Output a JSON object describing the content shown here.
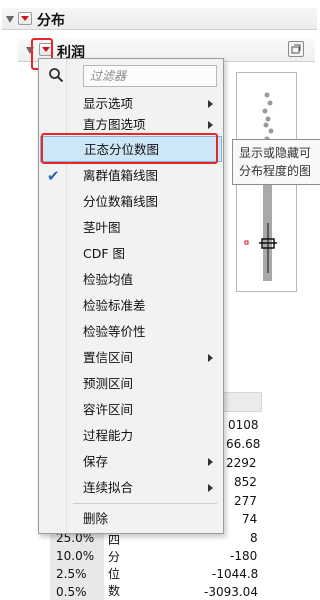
{
  "header": {
    "title": "分布"
  },
  "subheader": {
    "title": "利润"
  },
  "menu": {
    "filter_placeholder": "过滤器",
    "items": [
      {
        "label": "显示选项",
        "submenu": true,
        "checked": false
      },
      {
        "label": "直方图选项",
        "submenu": true,
        "checked": false
      },
      {
        "label": "正态分位数图",
        "submenu": false,
        "checked": false,
        "highlighted": true
      },
      {
        "label": "离群值箱线图",
        "submenu": false,
        "checked": true
      },
      {
        "label": "分位数箱线图",
        "submenu": false,
        "checked": false
      },
      {
        "label": "茎叶图",
        "submenu": false,
        "checked": false
      },
      {
        "label": "CDF 图",
        "submenu": false,
        "checked": false
      },
      {
        "label": "检验均值",
        "submenu": false,
        "checked": false
      },
      {
        "label": "检验标准差",
        "submenu": false,
        "checked": false
      },
      {
        "label": "检验等价性",
        "submenu": false,
        "checked": false
      },
      {
        "label": "置信区间",
        "submenu": true,
        "checked": false
      },
      {
        "label": "预测区间",
        "submenu": false,
        "checked": false
      },
      {
        "label": "容许区间",
        "submenu": false,
        "checked": false
      },
      {
        "label": "过程能力",
        "submenu": false,
        "checked": false
      },
      {
        "label": "保存",
        "submenu": true,
        "checked": false
      },
      {
        "label": "连续拟合",
        "submenu": true,
        "checked": false
      },
      {
        "label": "删除",
        "submenu": false,
        "checked": false
      }
    ]
  },
  "tooltip": {
    "line1": "显示或隐藏可",
    "line2": "分布程度的图"
  },
  "quantiles": {
    "right_values": [
      "0108",
      "66.68",
      "2292",
      "852",
      "277",
      "74"
    ],
    "rows": [
      {
        "pct": "25.0%",
        "label": "四分位数",
        "value": "8"
      },
      {
        "pct": "10.0%",
        "label": "",
        "value": "-180"
      },
      {
        "pct": "2.5%",
        "label": "",
        "value": "-1044.8"
      },
      {
        "pct": "0.5%",
        "label": "",
        "value": "-3093.04"
      }
    ]
  },
  "colors": {
    "accent_red": "#e8262c",
    "highlight": "#cde7f7",
    "check": "#2962b5"
  }
}
